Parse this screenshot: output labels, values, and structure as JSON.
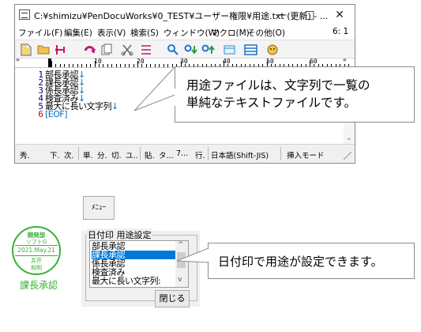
{
  "window": {
    "title": "C:¥shimizu¥PenDocuWorks¥0_TEST¥ユーザー権限¥用途.txt (更新) - ...",
    "controls": {
      "minimize": "—",
      "maximize": "□",
      "close": "✕"
    }
  },
  "menubar": {
    "items": [
      "ファイル(F)",
      "編集(E)",
      "表示(V)",
      "検索(S)",
      "ウィンドウ(W)",
      "マクロ(M)",
      "その他(O)"
    ],
    "right": "6: 1"
  },
  "toolbar": {
    "icons": [
      "new-file-icon",
      "open-folder-icon",
      "save-icon",
      "undo-icon",
      "copy-icon",
      "cut-icon",
      "paste-icon",
      "search-icon",
      "search-down-icon",
      "search-up-icon",
      "grep-icon",
      "list-icon",
      "settings-icon"
    ]
  },
  "ruler": {
    "marks": [
      "10",
      "20",
      "30",
      "40",
      "50",
      "60"
    ],
    "left": "»",
    "right": "«"
  },
  "editor": {
    "lines": [
      {
        "num": "1",
        "text": "部長承認",
        "eol": "↓"
      },
      {
        "num": "2",
        "text": "課長承認",
        "eol": "↓"
      },
      {
        "num": "3",
        "text": "係長承認",
        "eol": "↓"
      },
      {
        "num": "4",
        "text": "検査済み",
        "eol": "↓"
      },
      {
        "num": "5",
        "text": "最大に長い文字列",
        "eol": "↓"
      },
      {
        "num": "6",
        "text": "[EOF]",
        "eol": ""
      }
    ]
  },
  "statusbar": {
    "items": [
      "秀.",
      "下.",
      "次.",
      "単.",
      "分.",
      "切.",
      "ユ..",
      "貼.",
      "タ...",
      "7...",
      "行.",
      "日本語(Shift-JIS)",
      "挿入モード"
    ]
  },
  "callouts": {
    "top": "用途ファイルは、文字列で一覧の\n単純なテキストファイルです。",
    "bottom": "日付印で用途が設定できます。"
  },
  "stamp": {
    "top": "開発部",
    "top2": "ソフトG",
    "date": "2021.May.21",
    "bottom1": "井芹",
    "bottom2": "和明",
    "caption": "課長承認"
  },
  "dialog": {
    "menu_button": "ﾒﾆｭｰ",
    "group_label": "日付印 用途設定",
    "list_items": [
      "部長承認",
      "課長承認",
      "係長承認",
      "検査済み",
      "最大に長い文字列:"
    ],
    "selected_index": 1,
    "close_button": "閉じる"
  },
  "colors": {
    "accent": "#0078d7",
    "stamp_green": "#38b038",
    "line_number": "#00008b",
    "newline": "#0070c0"
  }
}
